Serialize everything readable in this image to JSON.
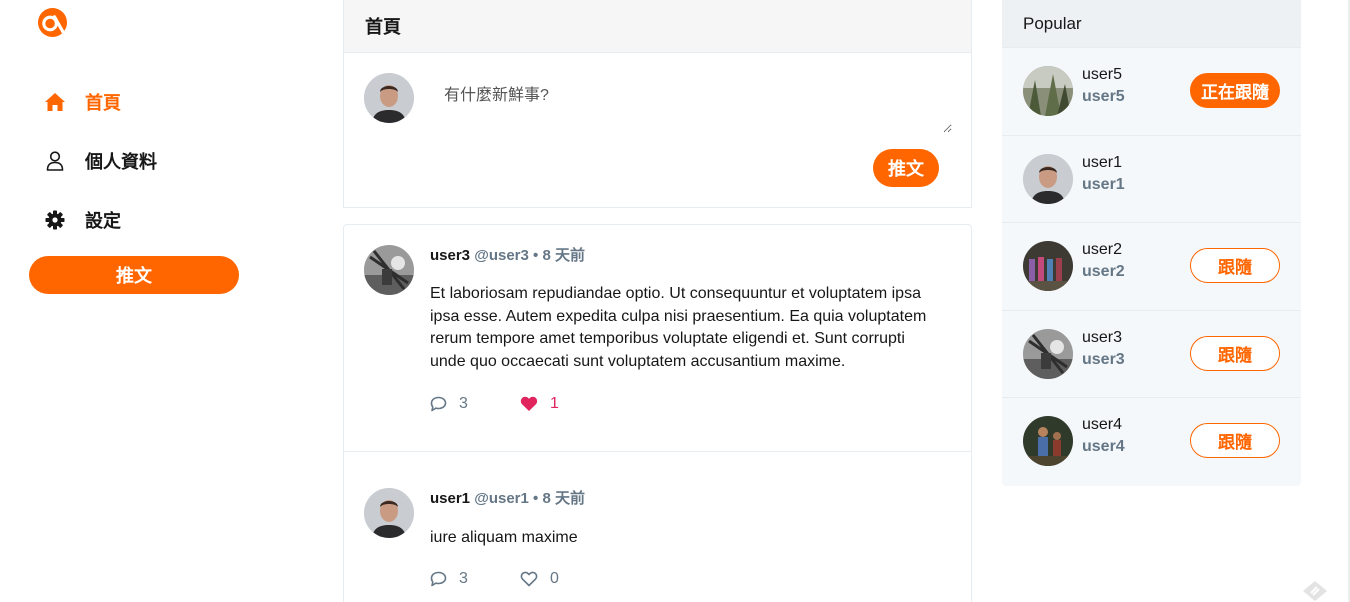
{
  "nav": {
    "items": [
      {
        "label": "首頁",
        "icon": "home-icon",
        "active": true
      },
      {
        "label": "個人資料",
        "icon": "user-icon",
        "active": false
      },
      {
        "label": "設定",
        "icon": "gear-icon",
        "active": false
      }
    ],
    "tweet_label": "推文"
  },
  "main": {
    "title": "首頁",
    "composer": {
      "placeholder": "有什麼新鮮事?",
      "tweet_label": "推文"
    },
    "tweets": [
      {
        "name": "user3",
        "handle": "@user3",
        "dot": "•",
        "time": "8 天前",
        "text": "Et laboriosam repudiandae optio. Ut consequuntur et voluptatem ipsa ipsa esse. Autem expedita culpa nisi praesentium. Ea quia voluptatem rerum tempore amet temporibus voluptate eligendi et. Sunt corrupti unde quo occaecati sunt voluptatem accusantium maxime.",
        "replies": "3",
        "likes": "1",
        "liked": true
      },
      {
        "name": "user1",
        "handle": "@user1",
        "dot": "•",
        "time": "8 天前",
        "text": "iure aliquam maxime",
        "replies": "3",
        "likes": "0",
        "liked": false
      }
    ]
  },
  "popular": {
    "title": "Popular",
    "users": [
      {
        "name": "user5",
        "handle": "user5",
        "button": "正在跟隨",
        "following": true
      },
      {
        "name": "user1",
        "handle": "user1",
        "button": "",
        "following": false
      },
      {
        "name": "user2",
        "handle": "user2",
        "button": "跟隨",
        "following": false
      },
      {
        "name": "user3",
        "handle": "user3",
        "button": "跟隨",
        "following": false
      },
      {
        "name": "user4",
        "handle": "user4",
        "button": "跟隨",
        "following": false
      }
    ]
  },
  "colors": {
    "accent": "#ff6600",
    "muted": "#657786",
    "like": "#e0245e"
  }
}
